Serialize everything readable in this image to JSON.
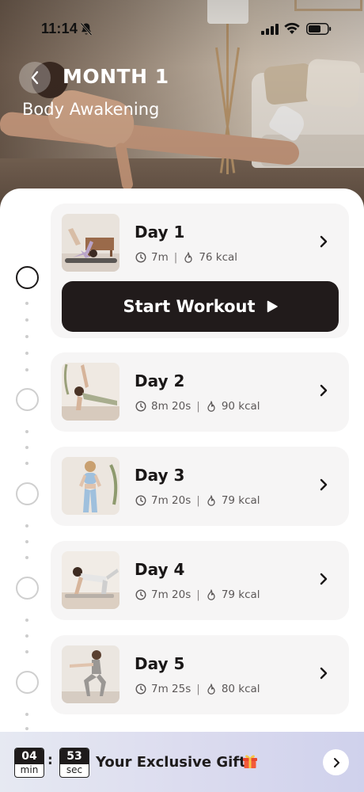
{
  "status_bar": {
    "time": "11:14"
  },
  "header": {
    "title": "MONTH 1",
    "subtitle": "Body Awakening"
  },
  "days": [
    {
      "title": "Day 1",
      "duration": "7m",
      "calories": "76 kcal",
      "active": true
    },
    {
      "title": "Day 2",
      "duration": "8m 20s",
      "calories": "90 kcal",
      "active": false
    },
    {
      "title": "Day 3",
      "duration": "7m 20s",
      "calories": "79 kcal",
      "active": false
    },
    {
      "title": "Day 4",
      "duration": "7m 20s",
      "calories": "79 kcal",
      "active": false
    },
    {
      "title": "Day 5",
      "duration": "7m 25s",
      "calories": "80 kcal",
      "active": false
    }
  ],
  "start_button": {
    "label": "Start Workout"
  },
  "offer": {
    "minutes": "04",
    "minutes_unit": "min",
    "seconds": "53",
    "seconds_unit": "sec",
    "separator": ":",
    "text": "Your Exclusive Gift"
  },
  "meta_separator": "|",
  "icons": {
    "back": "chevron-left-icon",
    "clock": "clock-icon",
    "flame": "flame-icon",
    "chevron": "chevron-right-icon",
    "play": "play-icon",
    "gift": "gift-icon",
    "bell_off": "bell-off-icon"
  },
  "colors": {
    "primary_dark": "#211b1b",
    "card_bg": "#f6f5f5",
    "timeline": "#cdcdcd",
    "offer_gradient_start": "#e6e9f2",
    "offer_gradient_end": "#cfd1ec"
  }
}
